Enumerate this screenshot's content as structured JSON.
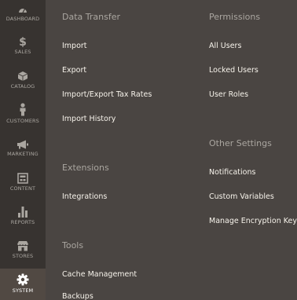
{
  "sidebar": {
    "items": [
      {
        "label": "DASHBOARD",
        "icon": "dashboard-icon"
      },
      {
        "label": "SALES",
        "icon": "dollar-icon"
      },
      {
        "label": "CATALOG",
        "icon": "box-icon"
      },
      {
        "label": "CUSTOMERS",
        "icon": "person-icon"
      },
      {
        "label": "MARKETING",
        "icon": "megaphone-icon"
      },
      {
        "label": "CONTENT",
        "icon": "layout-icon"
      },
      {
        "label": "REPORTS",
        "icon": "bar-chart-icon"
      },
      {
        "label": "STORES",
        "icon": "storefront-icon"
      },
      {
        "label": "SYSTEM",
        "icon": "gear-icon"
      }
    ],
    "active": "SYSTEM"
  },
  "menu": {
    "data_transfer": {
      "title": "Data Transfer",
      "links": [
        "Import",
        "Export",
        "Import/Export Tax Rates",
        "Import History"
      ]
    },
    "extensions": {
      "title": "Extensions",
      "links": [
        "Integrations"
      ]
    },
    "tools": {
      "title": "Tools",
      "links": [
        "Cache Management",
        "Backups"
      ]
    },
    "permissions": {
      "title": "Permissions",
      "links": [
        "All Users",
        "Locked Users",
        "User Roles"
      ]
    },
    "other_settings": {
      "title": "Other Settings",
      "links": [
        "Notifications",
        "Custom Variables",
        "Manage Encryption Key"
      ]
    }
  },
  "colors": {
    "sidebar_bg": "#373330",
    "panel_bg": "#4a4542",
    "active_bg": "#514943",
    "link": "#f7f3eb",
    "muted": "#aaa6a0"
  }
}
